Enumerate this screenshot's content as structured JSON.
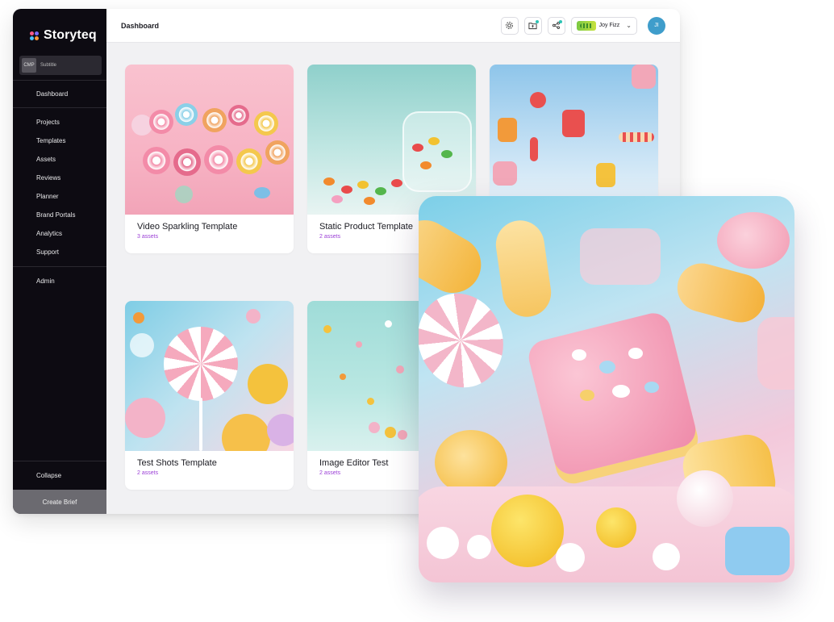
{
  "app": {
    "logo_text": "Storyteq",
    "workspace": {
      "badge": "CMP",
      "label": "Subtitle"
    },
    "nav": {
      "dashboard": "Dashboard",
      "projects": "Projects",
      "templates": "Templates",
      "assets": "Assets",
      "reviews": "Reviews",
      "planner": "Planner",
      "brand_portals": "Brand Portals",
      "analytics": "Analytics",
      "support": "Support",
      "admin": "Admin"
    },
    "collapse_label": "Collapse",
    "create_brief_label": "Create Brief"
  },
  "header": {
    "title": "Dashboard",
    "brand": "Joy Fizz",
    "avatar_initials": "JI",
    "icons": [
      "settings-icon",
      "folder-upload-icon",
      "share-icon"
    ]
  },
  "cards": [
    {
      "title": "Video Sparkling Template",
      "count": "3 assets"
    },
    {
      "title": "Static Product Template",
      "count": "2 assets"
    },
    {
      "title": "",
      "count": ""
    },
    {
      "title": "Test Shots Template",
      "count": "2 assets"
    },
    {
      "title": "Image Editor Test",
      "count": "2 assets"
    }
  ],
  "colors": {
    "sidebar_bg": "#0d0b12",
    "asset_count": "#9b3fd6",
    "avatar": "#3f9dcb",
    "create_brief_bg": "#6b6a70"
  }
}
